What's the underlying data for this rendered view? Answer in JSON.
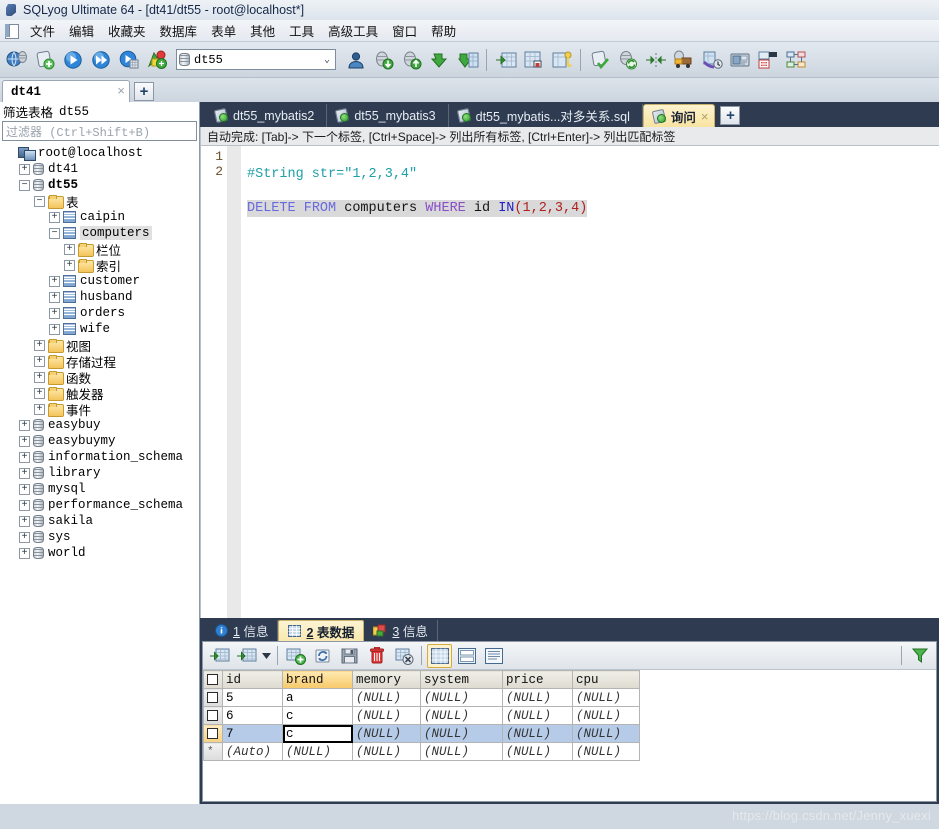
{
  "window": {
    "title": "SQLyog Ultimate 64 - [dt41/dt55 - root@localhost*]",
    "app_icon": "sqlyog-dolphin-icon"
  },
  "menubar": {
    "system_icon": "window-system-icon",
    "items": [
      {
        "label": "文件",
        "name": "menu-file"
      },
      {
        "label": "编辑",
        "name": "menu-edit"
      },
      {
        "label": "收藏夹",
        "name": "menu-favorites"
      },
      {
        "label": "数据库",
        "name": "menu-database"
      },
      {
        "label": "表单",
        "name": "menu-table"
      },
      {
        "label": "其他",
        "name": "menu-other"
      },
      {
        "label": "工具",
        "name": "menu-tools"
      },
      {
        "label": "高级工具",
        "name": "menu-powertools"
      },
      {
        "label": "窗口",
        "name": "menu-window"
      },
      {
        "label": "帮助",
        "name": "menu-help"
      }
    ]
  },
  "toolbar": {
    "db_selector": {
      "value": "dt55",
      "icon": "database-cylinder-icon",
      "chevron": "chevron-down-icon"
    },
    "buttons": [
      {
        "name": "new-connection-icon"
      },
      {
        "name": "new-query-tab-icon"
      },
      {
        "name": "execute-query-icon"
      },
      {
        "name": "execute-all-queries-icon"
      },
      {
        "name": "execute-query-current-icon"
      },
      {
        "name": "stop-execution-icon"
      }
    ],
    "buttons_right": [
      {
        "name": "user-manager-icon"
      },
      {
        "name": "import-database-icon"
      },
      {
        "name": "export-database-icon"
      },
      {
        "name": "restore-backup-icon"
      },
      {
        "name": "backup-database-icon"
      },
      {
        "name": "import-table-data-icon"
      },
      {
        "name": "export-table-data-icon"
      },
      {
        "name": "manage-indexes-icon"
      },
      {
        "name": "flush-icon"
      },
      {
        "name": "sync-database-icon"
      },
      {
        "name": "schema-sync-icon"
      },
      {
        "name": "data-transfer-icon"
      },
      {
        "name": "scheduled-job-icon"
      },
      {
        "name": "query-builder-icon"
      },
      {
        "name": "visual-schema-icon"
      },
      {
        "name": "er-diagram-icon"
      }
    ]
  },
  "connection_tabs": {
    "tabs": [
      {
        "label": "dt41",
        "close": "×",
        "name": "connection-tab-dt41"
      }
    ],
    "add_label": "+"
  },
  "sidebar": {
    "filter_label": "筛选表格",
    "filter_db": "dt55",
    "filter_placeholder": "过滤器 (Ctrl+Shift+B)",
    "tree": [
      {
        "label": "root@localhost",
        "icon": "host-icon",
        "expander": "",
        "depth": 0,
        "bold": false
      },
      {
        "label": "dt41",
        "icon": "database-cylinder-icon",
        "expander": "+",
        "depth": 1,
        "bold": false
      },
      {
        "label": "dt55",
        "icon": "database-cylinder-icon",
        "expander": "−",
        "depth": 1,
        "bold": true
      },
      {
        "label": "表",
        "icon": "folder-icon",
        "expander": "−",
        "depth": 2,
        "cjk": true
      },
      {
        "label": "caipin",
        "icon": "table-icon",
        "expander": "+",
        "depth": 3
      },
      {
        "label": "computers",
        "icon": "table-icon",
        "expander": "−",
        "depth": 3,
        "selected": true
      },
      {
        "label": "栏位",
        "icon": "folder-icon",
        "expander": "+",
        "depth": 4,
        "cjk": true
      },
      {
        "label": "索引",
        "icon": "folder-icon",
        "expander": "+",
        "depth": 4,
        "cjk": true
      },
      {
        "label": "customer",
        "icon": "table-icon",
        "expander": "+",
        "depth": 3
      },
      {
        "label": "husband",
        "icon": "table-icon",
        "expander": "+",
        "depth": 3
      },
      {
        "label": "orders",
        "icon": "table-icon",
        "expander": "+",
        "depth": 3
      },
      {
        "label": "wife",
        "icon": "table-icon",
        "expander": "+",
        "depth": 3
      },
      {
        "label": "视图",
        "icon": "folder-icon",
        "expander": "+",
        "depth": 2,
        "cjk": true
      },
      {
        "label": "存储过程",
        "icon": "folder-icon",
        "expander": "+",
        "depth": 2,
        "cjk": true
      },
      {
        "label": "函数",
        "icon": "folder-icon",
        "expander": "+",
        "depth": 2,
        "cjk": true
      },
      {
        "label": "触发器",
        "icon": "folder-icon",
        "expander": "+",
        "depth": 2,
        "cjk": true
      },
      {
        "label": "事件",
        "icon": "folder-icon",
        "expander": "+",
        "depth": 2,
        "cjk": true
      },
      {
        "label": "easybuy",
        "icon": "database-cylinder-icon",
        "expander": "+",
        "depth": 1
      },
      {
        "label": "easybuymy",
        "icon": "database-cylinder-icon",
        "expander": "+",
        "depth": 1
      },
      {
        "label": "information_schema",
        "icon": "database-cylinder-icon",
        "expander": "+",
        "depth": 1
      },
      {
        "label": "library",
        "icon": "database-cylinder-icon",
        "expander": "+",
        "depth": 1
      },
      {
        "label": "mysql",
        "icon": "database-cylinder-icon",
        "expander": "+",
        "depth": 1
      },
      {
        "label": "performance_schema",
        "icon": "database-cylinder-icon",
        "expander": "+",
        "depth": 1
      },
      {
        "label": "sakila",
        "icon": "database-cylinder-icon",
        "expander": "+",
        "depth": 1
      },
      {
        "label": "sys",
        "icon": "database-cylinder-icon",
        "expander": "+",
        "depth": 1
      },
      {
        "label": "world",
        "icon": "database-cylinder-icon",
        "expander": "+",
        "depth": 1
      }
    ]
  },
  "editor": {
    "tabs": [
      {
        "label": "dt55_mybatis2",
        "active": false,
        "icon": "query-tab-icon"
      },
      {
        "label": "dt55_mybatis3",
        "active": false,
        "icon": "query-tab-icon"
      },
      {
        "label": "dt55_mybatis...对多关系.sql",
        "active": false,
        "icon": "query-tab-icon"
      },
      {
        "label": "询问",
        "active": true,
        "icon": "query-tab-icon",
        "close": "×"
      }
    ],
    "add_label": "+",
    "hint": "自动完成: [Tab]-> 下一个标签, [Ctrl+Space]-> 列出所有标签, [Ctrl+Enter]-> 列出匹配标签",
    "lines": [
      {
        "n": "1",
        "text": "#String str=\"1,2,3,4\""
      },
      {
        "n": "2",
        "text": "DELETE FROM computers WHERE id IN(1,2,3,4)"
      }
    ]
  },
  "results": {
    "tabs": [
      {
        "num": "1",
        "label": "信息",
        "active": false,
        "icon": "info-icon",
        "name": "result-tab-message-1"
      },
      {
        "num": "2",
        "label": "表数据",
        "active": true,
        "icon": "table-grid-icon",
        "name": "result-tab-table-data"
      },
      {
        "num": "3",
        "label": "信息",
        "active": false,
        "icon": "info-colored-icon",
        "name": "result-tab-message-3"
      }
    ],
    "toolbar": [
      {
        "name": "insert-row-icon"
      },
      {
        "name": "insert-row-dropdown-icon"
      },
      {
        "name": "dropdown-arrow-icon"
      },
      {
        "name": "add-new-row-icon"
      },
      {
        "name": "refresh-data-icon"
      },
      {
        "name": "save-changes-icon"
      },
      {
        "name": "delete-row-icon"
      },
      {
        "name": "discard-changes-icon"
      },
      {
        "name": "grid-view-icon"
      },
      {
        "name": "form-view-icon"
      },
      {
        "name": "text-view-icon"
      },
      {
        "name": "filter-funnel-icon"
      }
    ],
    "grid": {
      "columns": [
        "id",
        "brand",
        "memory",
        "system",
        "price",
        "cpu"
      ],
      "highlighted_column": "brand",
      "rows": [
        {
          "cells": [
            "5",
            "a",
            "(NULL)",
            "(NULL)",
            "(NULL)",
            "(NULL)"
          ],
          "selected": false
        },
        {
          "cells": [
            "6",
            "c",
            "(NULL)",
            "(NULL)",
            "(NULL)",
            "(NULL)"
          ],
          "selected": false
        },
        {
          "cells": [
            "7",
            "c",
            "(NULL)",
            "(NULL)",
            "(NULL)",
            "(NULL)"
          ],
          "selected": true,
          "cursor_col": 1
        },
        {
          "cells": [
            "(Auto)",
            "(NULL)",
            "(NULL)",
            "(NULL)",
            "(NULL)",
            "(NULL)"
          ],
          "new_row": true,
          "marker": "*"
        }
      ]
    }
  },
  "watermark": "https://blog.csdn.net/Jenny_xuexi"
}
